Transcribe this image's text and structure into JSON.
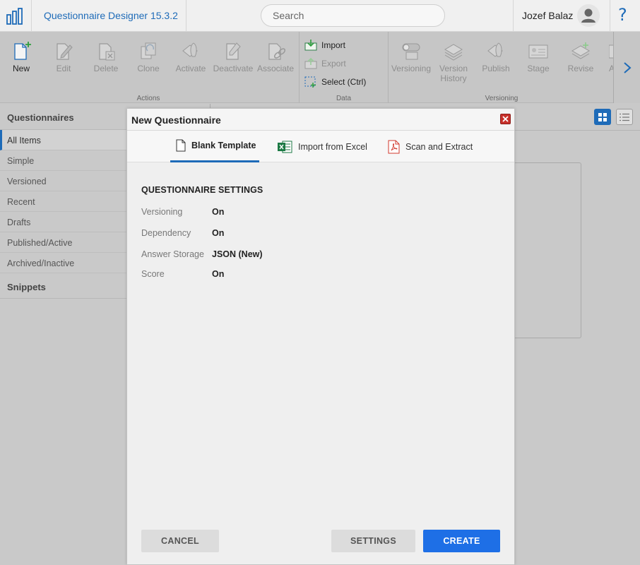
{
  "header": {
    "app_title": "Questionnaire Designer 15.3.2",
    "search_placeholder": "Search",
    "user_name": "Jozef Balaz",
    "help_label": "?"
  },
  "ribbon": {
    "actions": {
      "group_label": "Actions",
      "buttons": [
        {
          "label": "New",
          "icon": "new-document-icon",
          "enabled": true
        },
        {
          "label": "Edit",
          "icon": "edit-icon",
          "enabled": false
        },
        {
          "label": "Delete",
          "icon": "delete-icon",
          "enabled": false
        },
        {
          "label": "Clone",
          "icon": "clone-icon",
          "enabled": false
        },
        {
          "label": "Activate",
          "icon": "activate-rocket-icon",
          "enabled": false
        },
        {
          "label": "Deactivate",
          "icon": "deactivate-icon",
          "enabled": false
        },
        {
          "label": "Associate",
          "icon": "associate-link-icon",
          "enabled": false
        }
      ]
    },
    "data": {
      "group_label": "Data",
      "items": [
        {
          "label": "Import",
          "icon": "import-icon",
          "enabled": true
        },
        {
          "label": "Export",
          "icon": "export-icon",
          "enabled": false
        },
        {
          "label": "Select (Ctrl)",
          "icon": "select-icon",
          "enabled": true
        }
      ]
    },
    "versioning": {
      "group_label": "Versioning",
      "buttons": [
        {
          "label": "Versioning",
          "icon": "versioning-toggle-icon",
          "enabled": false
        },
        {
          "label": "Version History",
          "line1": "Version",
          "line2": "History",
          "icon": "version-history-icon",
          "enabled": false
        },
        {
          "label": "Publish",
          "icon": "publish-rocket-icon",
          "enabled": false
        },
        {
          "label": "Stage",
          "icon": "stage-icon",
          "enabled": false
        },
        {
          "label": "Revise",
          "icon": "revise-icon",
          "enabled": false
        },
        {
          "label": "A",
          "icon": "more-icon",
          "enabled": false
        }
      ]
    }
  },
  "sidebar": {
    "heading": "Questionnaires",
    "items": [
      {
        "label": "All Items",
        "selected": true
      },
      {
        "label": "Simple"
      },
      {
        "label": "Versioned"
      },
      {
        "label": "Recent"
      },
      {
        "label": "Drafts"
      },
      {
        "label": "Published/Active"
      },
      {
        "label": "Archived/Inactive"
      }
    ],
    "heading2": "Snippets"
  },
  "dialog": {
    "title": "New Questionnaire",
    "tabs": [
      {
        "label": "Blank Template",
        "icon": "document-icon",
        "active": true
      },
      {
        "label": "Import from Excel",
        "icon": "excel-icon"
      },
      {
        "label": "Scan and Extract",
        "icon": "pdf-icon"
      }
    ],
    "settings_title": "QUESTIONNAIRE SETTINGS",
    "settings": [
      {
        "label": "Versioning",
        "value": "On"
      },
      {
        "label": "Dependency",
        "value": "On"
      },
      {
        "label": "Answer Storage",
        "value": "JSON (New)"
      },
      {
        "label": "Score",
        "value": "On"
      }
    ],
    "buttons": {
      "cancel": "CANCEL",
      "settings": "SETTINGS",
      "create": "CREATE"
    }
  },
  "colors": {
    "accent": "#1e6bb8",
    "create_button": "#1e6fe6",
    "close_button": "#c7302a",
    "excel_green": "#1d7a45",
    "pdf_red": "#d23a2e"
  }
}
